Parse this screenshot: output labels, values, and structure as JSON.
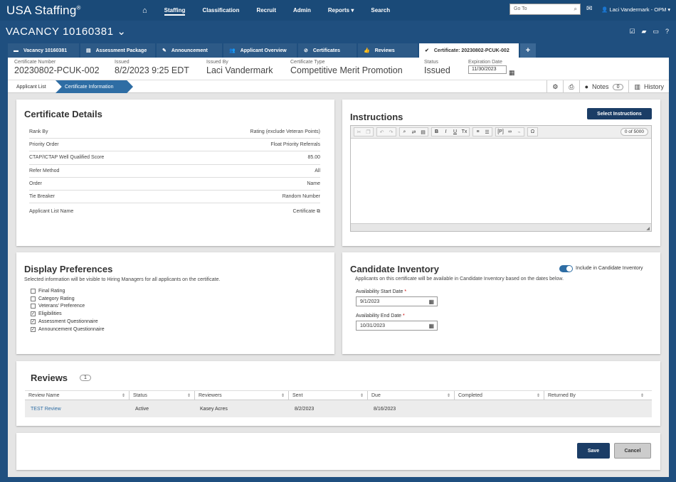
{
  "nav": {
    "logo": "USA Staffing",
    "logo_mark": "®",
    "items": [
      {
        "label": "Staffing",
        "active": true
      },
      {
        "label": "Classification"
      },
      {
        "label": "Recruit"
      },
      {
        "label": "Admin"
      },
      {
        "label": "Reports"
      },
      {
        "label": "Search"
      }
    ],
    "reports_caret": "▾",
    "goto_placeholder": "Go To",
    "user": "Laci Vandermark - OPM"
  },
  "vacancy": {
    "title": "VACANCY 10160381"
  },
  "tabs": [
    {
      "label": "Vacancy 10160381",
      "icon": "▬"
    },
    {
      "label": "Assessment Package",
      "icon": "▤"
    },
    {
      "label": "Announcement",
      "icon": "✎"
    },
    {
      "label": "Applicant Overview",
      "icon": "👥"
    },
    {
      "label": "Certificates",
      "icon": "⊘"
    },
    {
      "label": "Reviews",
      "icon": "👍"
    },
    {
      "label": "Certificate: 20230802-PCUK-002",
      "icon": "✔",
      "active": true
    }
  ],
  "tab_plus": "+",
  "header": {
    "cert_number": {
      "label": "Certificate Number",
      "value": "20230802-PCUK-002"
    },
    "issued": {
      "label": "Issued",
      "value": "8/2/2023 9:25 EDT"
    },
    "issued_by": {
      "label": "Issued By",
      "value": "Laci Vandermark"
    },
    "cert_type": {
      "label": "Certificate Type",
      "value": "Competitive Merit Promotion"
    },
    "status": {
      "label": "Status",
      "value": "Issued"
    },
    "expiration": {
      "label": "Expiration Date",
      "value": "11/30/2023"
    }
  },
  "breadcrumb": {
    "step1": "Applicant List",
    "step2": "Certificate Information"
  },
  "tools": {
    "notes_label": "Notes",
    "notes_count": "0",
    "history_label": "History"
  },
  "cert_details": {
    "title": "Certificate Details",
    "rows": [
      {
        "label": "Rank By",
        "value": "Rating (exclude Veteran Points)"
      },
      {
        "label": "Priority Order",
        "value": "Float Priority Referrals"
      },
      {
        "label": "CTAP/ICTAP Well Qualified Score",
        "value": "85.00"
      },
      {
        "label": "Refer Method",
        "value": "All"
      },
      {
        "label": "Order",
        "value": "Name"
      },
      {
        "label": "Tie Breaker",
        "value": "Random Number"
      },
      {
        "label": "Applicant List Name",
        "value": "Certificate"
      }
    ]
  },
  "instructions": {
    "title": "Instructions",
    "select_button": "Select Instructions",
    "counter": "0 of 5000"
  },
  "display_prefs": {
    "title": "Display Preferences",
    "description": "Selected information will be visible to Hiring Managers for all applicants on the certificate.",
    "options": [
      {
        "label": "Final Rating",
        "checked": false
      },
      {
        "label": "Category Rating",
        "checked": false
      },
      {
        "label": "Veterans' Preference",
        "checked": false
      },
      {
        "label": "Eligibilities",
        "checked": true
      },
      {
        "label": "Assessment Questionnaire",
        "checked": true
      },
      {
        "label": "Announcement Questionnaire",
        "checked": true
      }
    ]
  },
  "candidate_inventory": {
    "title": "Candidate Inventory",
    "toggle_label": "Include in Candidate Inventory",
    "toggle_on": true,
    "description": "Applicants on this certificate will be available in Candidate Inventory based on the dates below.",
    "start_label": "Availability Start Date",
    "start_value": "9/1/2023",
    "end_label": "Availability End Date",
    "end_value": "10/31/2023",
    "required_mark": "*"
  },
  "reviews": {
    "title": "Reviews",
    "count": "1",
    "columns": [
      "Review Name",
      "Status",
      "Reviewers",
      "Sent",
      "Due",
      "Completed",
      "Returned By"
    ],
    "sort_glyph": "⇕",
    "rows": [
      {
        "name": "TEST Review",
        "status": "Active",
        "reviewers": "Kasey Acres",
        "sent": "8/2/2023",
        "due": "8/16/2023",
        "completed": "",
        "returned_by": ""
      }
    ]
  },
  "footer": {
    "save": "Save",
    "cancel": "Cancel"
  },
  "colors": {
    "nav_bg": "#1a4a78",
    "accent": "#2e6da4",
    "button_dark": "#1b3d66"
  }
}
